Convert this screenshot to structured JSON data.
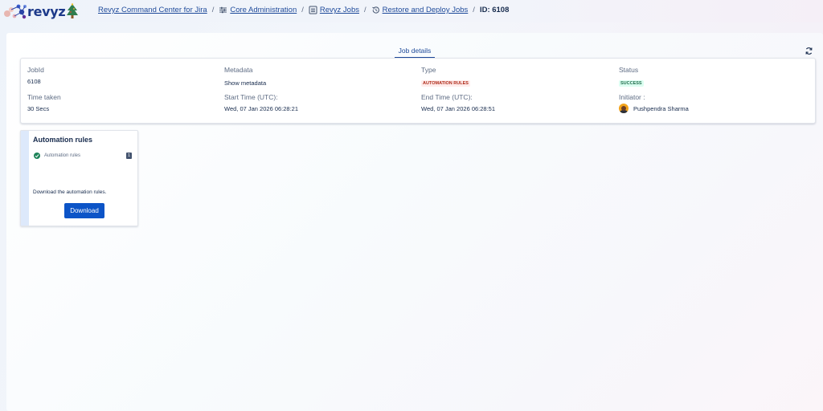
{
  "app": {
    "logo_text": "revyz"
  },
  "breadcrumb": {
    "items": [
      {
        "label": "Revyz Command Center for Jira",
        "icon": ""
      },
      {
        "label": "Core Administration",
        "icon": "sliders-icon"
      },
      {
        "label": "Revyz Jobs",
        "icon": "list-icon"
      },
      {
        "label": "Restore and Deploy Jobs",
        "icon": "history-icon"
      }
    ],
    "separator": "/",
    "current": "ID: 6108"
  },
  "tabs": [
    {
      "label": "Job details",
      "active": true
    }
  ],
  "refresh_icon": "refresh-icon",
  "job": {
    "job_id_label": "JobId",
    "job_id_value": "6108",
    "metadata_label": "Metadata",
    "metadata_value": "Show metadata",
    "type_label": "Type",
    "type_value": "AUTOMATION RULES",
    "status_label": "Status",
    "status_value": "SUCCESS",
    "time_taken_label": "Time taken",
    "time_taken_value": "30 Secs",
    "start_time_label": "Start Time (UTC):",
    "start_time_value": "Wed, 07 Jan 2026 06:28:21",
    "end_time_label": "End Time (UTC):",
    "end_time_value": "Wed, 07 Jan 2026 06:28:51",
    "initiator_label": "Initiator :",
    "initiator_value": "Pushpendra Sharma"
  },
  "automation_card": {
    "title": "Automation rules",
    "item_label": "Automation rules",
    "item_count": "1",
    "description": "Download the automation rules.",
    "download_label": "Download"
  },
  "colors": {
    "accent": "#0c54c7",
    "link": "#1e4a9a",
    "type_lozenge_bg": "#ffeceb",
    "type_lozenge_text": "#ae2a19",
    "status_lozenge_bg": "#dcfff1",
    "status_lozenge_text": "#216e4e",
    "success_icon": "#1f845a"
  }
}
